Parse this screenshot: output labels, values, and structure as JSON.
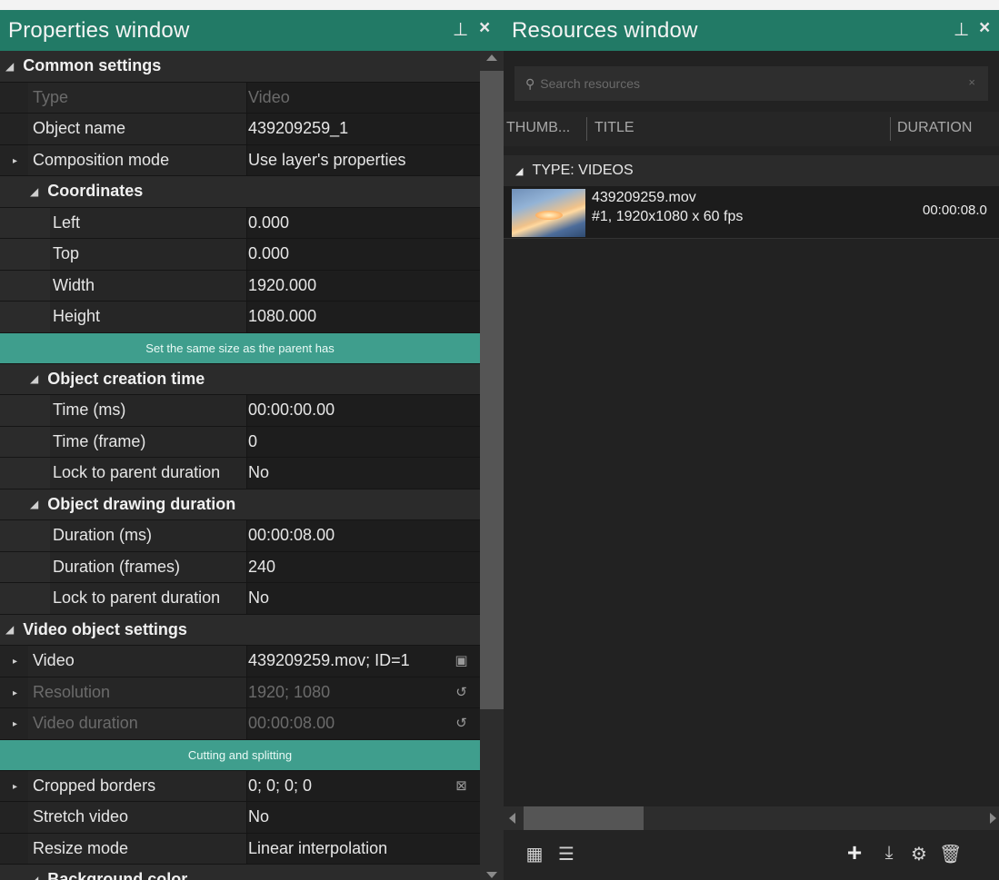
{
  "properties": {
    "title": "Properties window",
    "pin": "⊥",
    "close": "×",
    "rows": [
      {
        "kind": "sec",
        "level": 0,
        "label": "Common settings"
      },
      {
        "kind": "item",
        "level": 0,
        "label": "Type",
        "value": "Video",
        "disabled": true
      },
      {
        "kind": "item",
        "level": 0,
        "label": "Object name",
        "value": "439209259_1"
      },
      {
        "kind": "item",
        "level": 0,
        "label": "Composition mode",
        "value": "Use layer's properties",
        "expander": true
      },
      {
        "kind": "sec",
        "level": 1,
        "label": "Coordinates"
      },
      {
        "kind": "item",
        "level": 1,
        "label": "Left",
        "value": "0.000"
      },
      {
        "kind": "item",
        "level": 1,
        "label": "Top",
        "value": "0.000"
      },
      {
        "kind": "item",
        "level": 1,
        "label": "Width",
        "value": "1920.000"
      },
      {
        "kind": "item",
        "level": 1,
        "label": "Height",
        "value": "1080.000"
      },
      {
        "kind": "button",
        "label": "Set the same size as the parent has"
      },
      {
        "kind": "sec",
        "level": 1,
        "label": "Object creation time"
      },
      {
        "kind": "item",
        "level": 1,
        "label": "Time (ms)",
        "value": "00:00:00.00"
      },
      {
        "kind": "item",
        "level": 1,
        "label": "Time (frame)",
        "value": "0"
      },
      {
        "kind": "item",
        "level": 1,
        "label": "Lock to parent duration",
        "value": "No"
      },
      {
        "kind": "sec",
        "level": 1,
        "label": "Object drawing duration"
      },
      {
        "kind": "item",
        "level": 1,
        "label": "Duration (ms)",
        "value": "00:00:08.00"
      },
      {
        "kind": "item",
        "level": 1,
        "label": "Duration (frames)",
        "value": "240"
      },
      {
        "kind": "item",
        "level": 1,
        "label": "Lock to parent duration",
        "value": "No"
      },
      {
        "kind": "sec",
        "level": 0,
        "label": "Video object settings"
      },
      {
        "kind": "item",
        "level": 0,
        "label": "Video",
        "value": "439209259.mov; ID=1",
        "expander": true,
        "icon": "film-icon"
      },
      {
        "kind": "item",
        "level": 0,
        "label": "Resolution",
        "value": "1920; 1080",
        "expander": true,
        "disabled": true,
        "icon": "reset-icon"
      },
      {
        "kind": "item",
        "level": 0,
        "label": "Video duration",
        "value": "00:00:08.00",
        "expander": true,
        "disabled": true,
        "icon": "reset-icon"
      },
      {
        "kind": "button",
        "label": "Cutting and splitting"
      },
      {
        "kind": "item",
        "level": 0,
        "label": "Cropped borders",
        "value": "0; 0; 0; 0",
        "expander": true,
        "icon": "crop-icon"
      },
      {
        "kind": "item",
        "level": 0,
        "label": "Stretch video",
        "value": "No"
      },
      {
        "kind": "item",
        "level": 0,
        "label": "Resize mode",
        "value": "Linear interpolation"
      },
      {
        "kind": "sec",
        "level": 1,
        "label": "Background color"
      }
    ]
  },
  "resources": {
    "title": "Resources window",
    "pin": "⊥",
    "close": "×",
    "search_placeholder": "Search resources",
    "search_clear": "×",
    "columns": [
      "THUMB...",
      "TITLE",
      "DURATION"
    ],
    "group": "TYPE: VIDEOS",
    "items": [
      {
        "name": "439209259.mov",
        "meta": "#1, 1920x1080 x 60 fps",
        "duration": "00:00:08.0"
      }
    ]
  },
  "icons": {
    "expander": "▸",
    "collapse": "◢",
    "film": "▣",
    "reset": "↺",
    "crop": "⊠",
    "search": "⚲"
  }
}
